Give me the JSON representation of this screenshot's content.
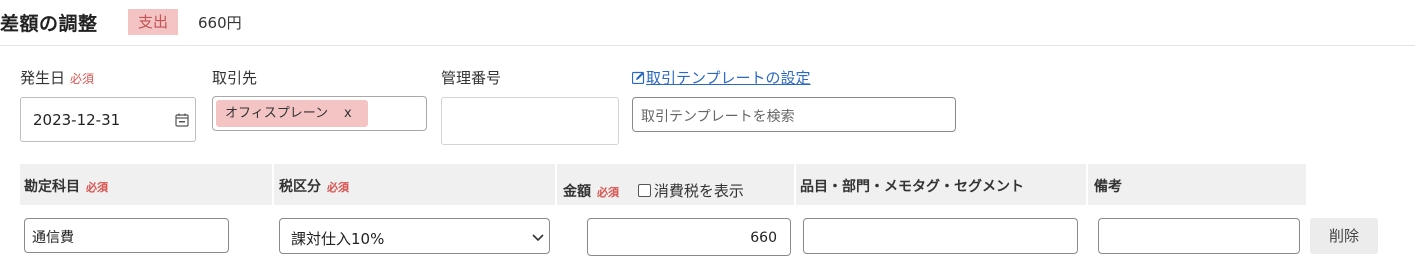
{
  "header": {
    "title": "差額の調整",
    "badge": "支出",
    "amount": "660円"
  },
  "form": {
    "date_label": "発生日",
    "required": "必須",
    "date_value": "2023-12-31",
    "partner_label": "取引先",
    "partner_tag": "オフィスプレーン",
    "partner_tag_remove": "x",
    "mgmt_label": "管理番号",
    "template_link": "取引テンプレートの設定",
    "template_search_placeholder": "取引テンプレートを検索"
  },
  "table": {
    "headers": {
      "account": "勘定科目",
      "tax": "税区分",
      "amount": "金額",
      "show_tax": "消費税を表示",
      "items": "品目・部門・メモタグ・セグメント",
      "memo": "備考"
    },
    "row": {
      "account": "通信費",
      "tax": "課対仕入10%",
      "amount": "660",
      "items": "",
      "memo": "",
      "delete": "削除"
    }
  },
  "colors": {
    "badge_bg": "#f4c4c4",
    "required": "#d9534f",
    "link": "#2a68c4",
    "header_bg": "#f0f0f0"
  },
  "icons": [
    "calendar-icon",
    "edit-icon",
    "chevron-down-icon",
    "checkbox"
  ]
}
